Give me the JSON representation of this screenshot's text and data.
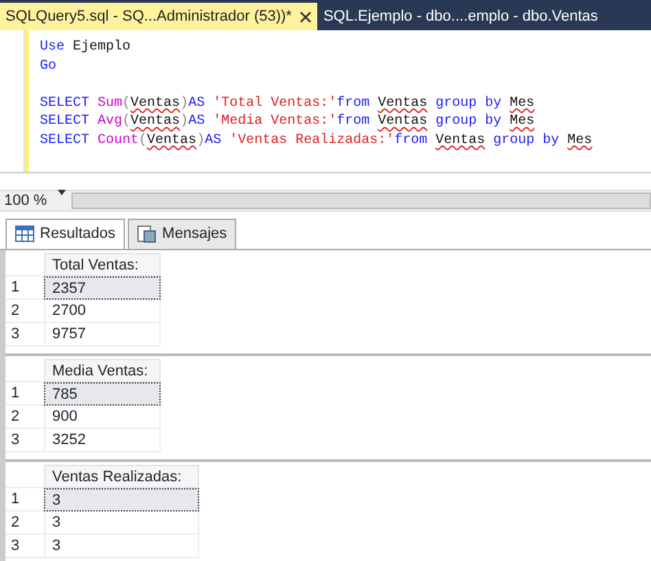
{
  "tabs": [
    {
      "label": "SQLQuery5.sql - SQ...Administrador (53))*",
      "selected": true
    },
    {
      "label": "SQL.Ejemplo - dbo....emplo - dbo.Ventas",
      "selected": false
    }
  ],
  "editor": {
    "lines": [
      [
        {
          "kind": "keyword",
          "text": "Use"
        },
        {
          "kind": "plain",
          "text": " Ejemplo"
        }
      ],
      [
        {
          "kind": "keyword",
          "text": "Go"
        }
      ],
      [
        {
          "kind": "blank"
        }
      ],
      [
        {
          "kind": "keyword",
          "text": "SELECT "
        },
        {
          "kind": "function",
          "text": "Sum"
        },
        {
          "kind": "paren",
          "text": "("
        },
        {
          "kind": "error",
          "text": "Ventas"
        },
        {
          "kind": "paren",
          "text": ")"
        },
        {
          "kind": "keyword",
          "text": "AS "
        },
        {
          "kind": "string",
          "text": "'Total Ventas:'"
        },
        {
          "kind": "keyword",
          "text": "from "
        },
        {
          "kind": "error",
          "text": "Ventas"
        },
        {
          "kind": "keyword",
          "text": " group by "
        },
        {
          "kind": "error",
          "text": "Mes"
        }
      ],
      [
        {
          "kind": "keyword",
          "text": "SELECT "
        },
        {
          "kind": "function",
          "text": "Avg"
        },
        {
          "kind": "paren",
          "text": "("
        },
        {
          "kind": "error",
          "text": "Ventas"
        },
        {
          "kind": "paren",
          "text": ")"
        },
        {
          "kind": "keyword",
          "text": "AS "
        },
        {
          "kind": "string",
          "text": "'Media Ventas:'"
        },
        {
          "kind": "keyword",
          "text": "from "
        },
        {
          "kind": "error",
          "text": "Ventas"
        },
        {
          "kind": "keyword",
          "text": " group by "
        },
        {
          "kind": "error",
          "text": "Mes"
        }
      ],
      [
        {
          "kind": "keyword",
          "text": "SELECT "
        },
        {
          "kind": "function",
          "text": "Count"
        },
        {
          "kind": "paren",
          "text": "("
        },
        {
          "kind": "error",
          "text": "Ventas"
        },
        {
          "kind": "paren",
          "text": ")"
        },
        {
          "kind": "keyword",
          "text": "AS "
        },
        {
          "kind": "string",
          "text": "'Ventas Realizadas:'"
        },
        {
          "kind": "keyword",
          "text": "from "
        },
        {
          "kind": "error",
          "text": "Ventas"
        },
        {
          "kind": "keyword",
          "text": " group by "
        },
        {
          "kind": "error",
          "text": "Mes"
        }
      ]
    ]
  },
  "zoom": "100 %",
  "result_tabs": [
    {
      "label": "Resultados",
      "selected": true,
      "kind": "grid"
    },
    {
      "label": "Mensajes",
      "selected": false,
      "kind": "messages"
    }
  ],
  "grids": [
    {
      "column": "Total Ventas:",
      "rows": [
        {
          "num": "1",
          "value": "2357",
          "selected": true
        },
        {
          "num": "2",
          "value": "2700",
          "selected": false
        },
        {
          "num": "3",
          "value": "9757",
          "selected": false
        }
      ]
    },
    {
      "column": "Media Ventas:",
      "rows": [
        {
          "num": "1",
          "value": "785",
          "selected": true
        },
        {
          "num": "2",
          "value": "900",
          "selected": false
        },
        {
          "num": "3",
          "value": "3252",
          "selected": false
        }
      ]
    },
    {
      "column": "Ventas Realizadas:",
      "rows": [
        {
          "num": "1",
          "value": "3",
          "selected": true
        },
        {
          "num": "2",
          "value": "3",
          "selected": false
        },
        {
          "num": "3",
          "value": "3",
          "selected": false
        }
      ]
    }
  ]
}
